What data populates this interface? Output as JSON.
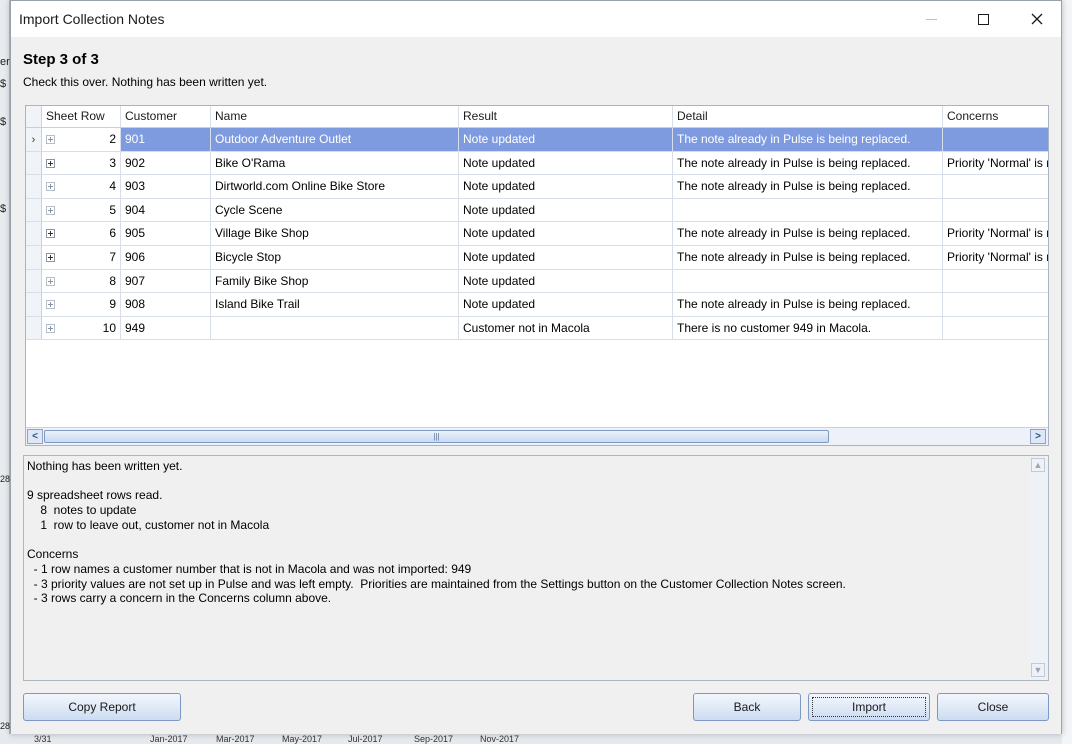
{
  "window": {
    "title": "Import Collection Notes"
  },
  "step": {
    "title": "Step 3 of 3",
    "subtitle": "Check this over.  Nothing has been written yet."
  },
  "grid": {
    "columns": [
      "Sheet Row",
      "Customer",
      "Name",
      "Result",
      "Detail",
      "Concerns"
    ],
    "rows": [
      {
        "sheet_row": "2",
        "customer": "901",
        "name": "Outdoor Adventure Outlet",
        "result": "Note updated",
        "detail": "The note already in Pulse is being replaced.",
        "concerns": ""
      },
      {
        "sheet_row": "3",
        "customer": "902",
        "name": "Bike O'Rama",
        "result": "Note updated",
        "detail": "The note already in Pulse is being replaced.",
        "concerns": "Priority 'Normal' is n"
      },
      {
        "sheet_row": "4",
        "customer": "903",
        "name": "Dirtworld.com Online Bike Store",
        "result": "Note updated",
        "detail": "The note already in Pulse is being replaced.",
        "concerns": ""
      },
      {
        "sheet_row": "5",
        "customer": "904",
        "name": "Cycle Scene",
        "result": "Note updated",
        "detail": "",
        "concerns": ""
      },
      {
        "sheet_row": "6",
        "customer": "905",
        "name": "Village Bike Shop",
        "result": "Note updated",
        "detail": "The note already in Pulse is being replaced.",
        "concerns": "Priority 'Normal' is n"
      },
      {
        "sheet_row": "7",
        "customer": "906",
        "name": "Bicycle Stop",
        "result": "Note updated",
        "detail": "The note already in Pulse is being replaced.",
        "concerns": "Priority 'Normal' is n"
      },
      {
        "sheet_row": "8",
        "customer": "907",
        "name": "Family Bike Shop",
        "result": "Note updated",
        "detail": "",
        "concerns": ""
      },
      {
        "sheet_row": "9",
        "customer": "908",
        "name": "Island Bike Trail",
        "result": "Note updated",
        "detail": "The note already in Pulse is being replaced.",
        "concerns": ""
      },
      {
        "sheet_row": "10",
        "customer": "949",
        "name": "",
        "result": "Customer not in Macola",
        "detail": "There is no customer 949 in Macola.",
        "concerns": ""
      }
    ]
  },
  "report": {
    "lines": [
      "Nothing has been written yet.",
      "",
      "9 spreadsheet rows read.",
      "    8  notes to update",
      "    1  row to leave out, customer not in Macola",
      "",
      "Concerns",
      "  - 1 row names a customer number that is not in Macola and was not imported: 949",
      "  - 3 priority values are not set up in Pulse and was left empty.  Priorities are maintained from the Settings button on the Customer Collection Notes screen.",
      "  - 3 rows carry a concern in the Concerns column above."
    ]
  },
  "buttons": {
    "copy_report": "Copy Report",
    "back": "Back",
    "import": "Import",
    "close": "Close"
  },
  "background": {
    "left_labels": [
      "er",
      "$",
      "$",
      "$",
      "28",
      "28"
    ],
    "bottom_labels": [
      "3/31",
      "Jan-2017",
      "Mar-2017",
      "May-2017",
      "Jul-2017",
      "Sep-2017",
      "Nov-2017"
    ]
  }
}
